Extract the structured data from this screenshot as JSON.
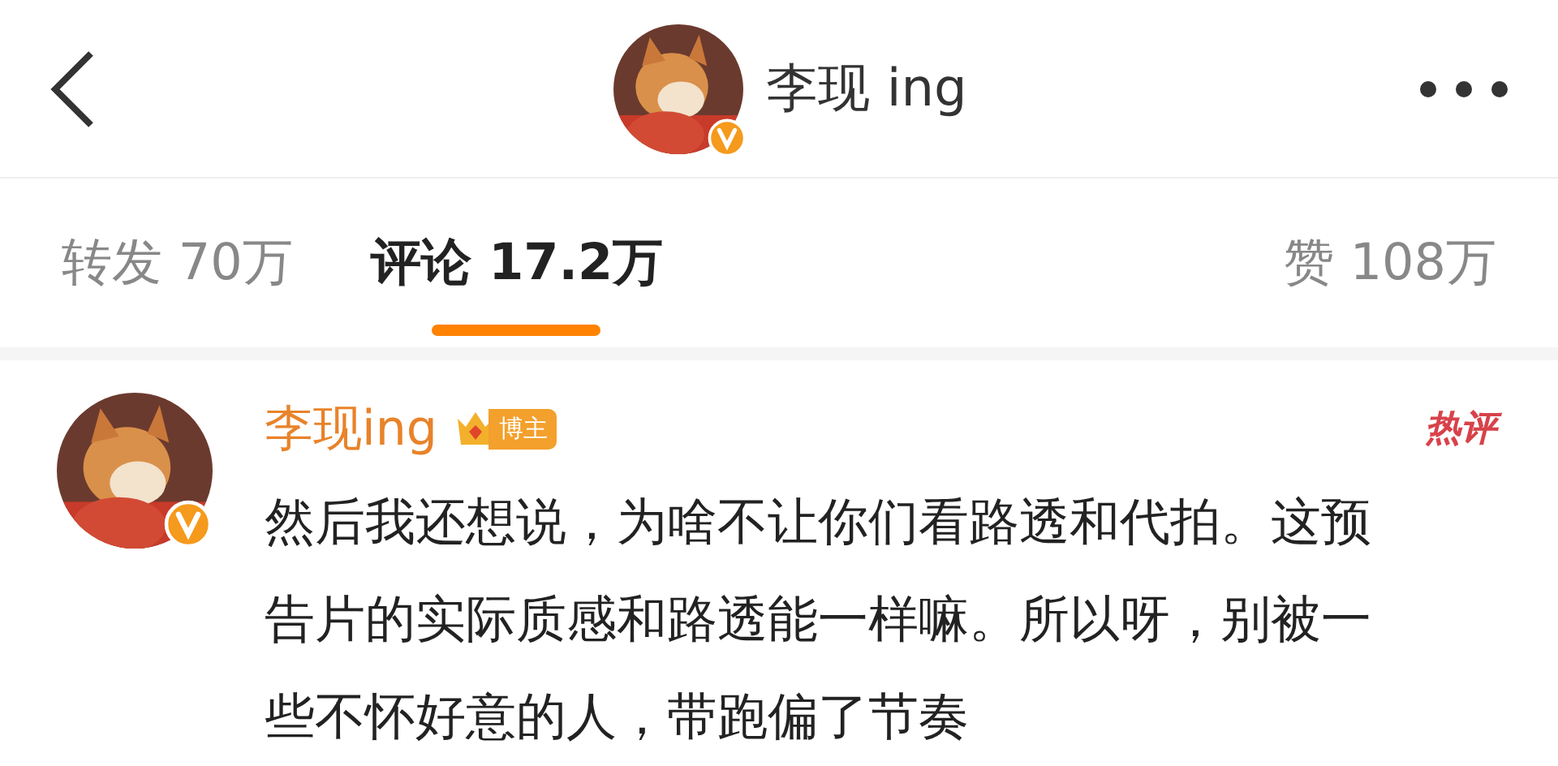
{
  "header": {
    "title": "李现 ing",
    "verified": true
  },
  "tabs": [
    {
      "label": "转发 70万",
      "selected": false
    },
    {
      "label": "评论 17.2万",
      "selected": true
    },
    {
      "label": "赞 108万",
      "selected": false
    }
  ],
  "comment": {
    "author": "李现ing",
    "verified": true,
    "badge": "博主",
    "tag": "热评",
    "text": "然后我还想说，为啥不让你们看路透和代拍。这预告片的实际质感和路透能一样嘛。所以呀，别被一些不怀好意的人，带跑偏了节奏"
  }
}
